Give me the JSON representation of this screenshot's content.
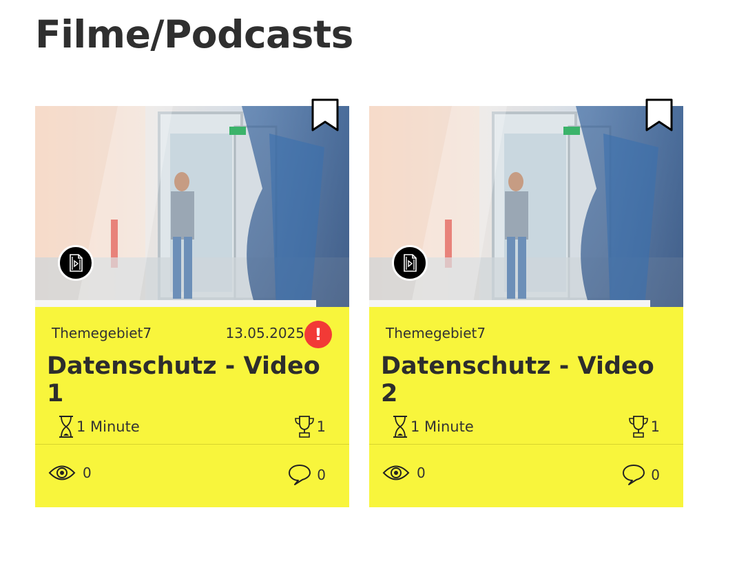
{
  "page": {
    "title": "Filme/Podcasts"
  },
  "colors": {
    "card_background": "#f8f53c",
    "alert": "#f23a36",
    "text": "#2d2d2d"
  },
  "cards": [
    {
      "topic": "Themegebiet7",
      "date": "13.05.2025",
      "alert": "!",
      "title": "Datenschutz - Video 1",
      "duration": "1 Minute",
      "points": "1",
      "views": "0",
      "comments": "0",
      "icons": {
        "media": "video-file-icon",
        "bookmark": "bookmark-icon",
        "duration": "hourglass-icon",
        "points": "trophy-icon",
        "views": "eye-icon",
        "comments": "speech-bubble-icon"
      }
    },
    {
      "topic": "Themegebiet7",
      "title": "Datenschutz - Video 2",
      "duration": "1 Minute",
      "points": "1",
      "views": "0",
      "comments": "0",
      "icons": {
        "media": "video-file-icon",
        "bookmark": "bookmark-icon",
        "duration": "hourglass-icon",
        "points": "trophy-icon",
        "views": "eye-icon",
        "comments": "speech-bubble-icon"
      }
    }
  ]
}
